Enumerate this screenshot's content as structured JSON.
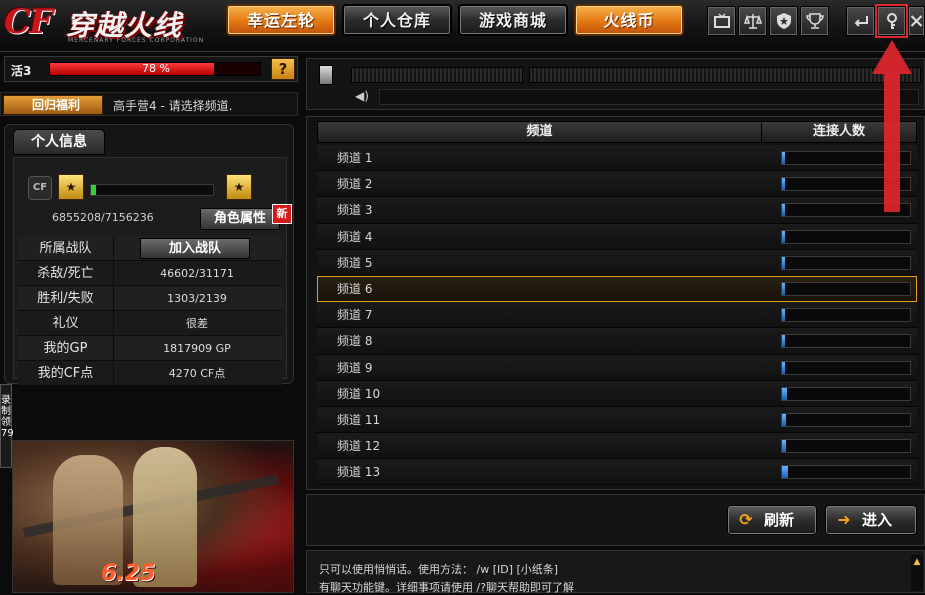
{
  "topbar": {
    "logo": {
      "mark": "CF",
      "title": "穿越火线",
      "subtitle": "MERCENARY FORCES CORPORATION"
    },
    "nav": [
      {
        "label": "幸运左轮",
        "style": "orange"
      },
      {
        "label": "个人仓库",
        "style": "dark"
      },
      {
        "label": "游戏商城",
        "style": "dark"
      },
      {
        "label": "火线币",
        "style": "orange"
      }
    ],
    "tools": [
      "tv-icon",
      "scale-icon",
      "shield-star-icon",
      "trophy-icon",
      "back-icon",
      "key-icon",
      "close-icon"
    ]
  },
  "vitality": {
    "label": "活3",
    "percent": 78,
    "text": "78 %",
    "help": "?"
  },
  "notice": {
    "tag": "回归福利",
    "text": "高手营4 - 请选择频道."
  },
  "profile": {
    "tab": "个人信息",
    "emblem": "CF",
    "rank_left": "★",
    "rank_right": "★",
    "xp_fraction": 0.045,
    "xp_text": "6855208/7156236",
    "role_button": "角色属性",
    "new_badge": "新",
    "stats": [
      {
        "label": "所属战队",
        "value": "",
        "button": "加入战队"
      },
      {
        "label": "杀敌/死亡",
        "value": "46602/31171"
      },
      {
        "label": "胜利/失败",
        "value": "1303/2139"
      },
      {
        "label": "礼仪",
        "value": "很差"
      },
      {
        "label": "我的GP",
        "value": "1817909 GP"
      },
      {
        "label": "我的CF点",
        "value": "4270 CF点"
      }
    ]
  },
  "side_tab": "录\n制\n领\n79",
  "promo": {
    "date": "6.25"
  },
  "channels": {
    "header_name": "频道",
    "header_count": "连接人数",
    "selected_index": 5,
    "rows": [
      {
        "name": "频道 1",
        "load": 0.02
      },
      {
        "name": "频道 2",
        "load": 0.02
      },
      {
        "name": "频道 3",
        "load": 0.02
      },
      {
        "name": "频道 4",
        "load": 0.02
      },
      {
        "name": "频道 5",
        "load": 0.02
      },
      {
        "name": "频道 6",
        "load": 0.02
      },
      {
        "name": "频道 7",
        "load": 0.02
      },
      {
        "name": "频道 8",
        "load": 0.02
      },
      {
        "name": "频道 9",
        "load": 0.02
      },
      {
        "name": "频道 10",
        "load": 0.04
      },
      {
        "name": "频道 11",
        "load": 0.03
      },
      {
        "name": "频道 12",
        "load": 0.03
      },
      {
        "name": "频道 13",
        "load": 0.05
      }
    ]
  },
  "actions": {
    "refresh": "刷新",
    "enter": "进入"
  },
  "chat": {
    "lines": [
      "只可以使用悄悄话。使用方法： /w [ID] [小纸条]",
      "有聊天功能键。详细事项请使用 /?聊天帮助即可了解"
    ]
  },
  "colors": {
    "accent": "#e57d16",
    "selected": "#e49b2a",
    "annotation": "#e0262b"
  }
}
